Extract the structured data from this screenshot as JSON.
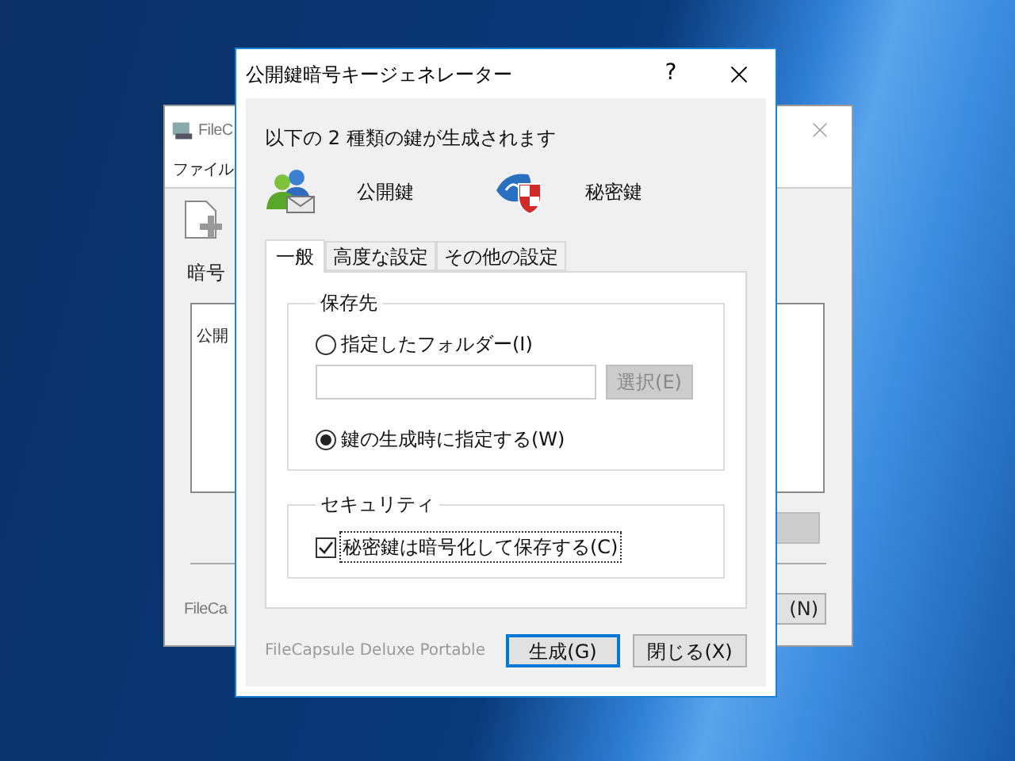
{
  "background_window": {
    "title": "FileC",
    "menu": [
      "ファイル"
    ],
    "label": "暗号",
    "list_item": "公開",
    "footer": "FileCa",
    "button": "(N)"
  },
  "dialog": {
    "title": "公開鍵暗号キージェネレーター",
    "help": "?",
    "intro": "以下の 2 種類の鍵が生成されます",
    "keys": [
      {
        "kind": "public",
        "label": "公開鍵"
      },
      {
        "kind": "private",
        "label": "秘密鍵"
      }
    ],
    "tabs": [
      {
        "label": "一般",
        "selected": true
      },
      {
        "label": "高度な設定",
        "selected": false
      },
      {
        "label": "その他の設定",
        "selected": false
      }
    ],
    "destination": {
      "title": "保存先",
      "options": [
        {
          "label": "指定したフォルダー(I)",
          "selected": false
        },
        {
          "label": "鍵の生成時に指定する(W)",
          "selected": true
        }
      ],
      "folder_field": {
        "disabled": true
      },
      "browse_button": {
        "label": "選択(E)",
        "disabled": true
      }
    },
    "security": {
      "title": "セキュリティ",
      "checkbox": {
        "label": "秘密鍵は暗号化して保存する(C)",
        "checked": true
      }
    },
    "footer": "FileCapsule Deluxe Portable",
    "buttons": [
      {
        "label": "生成(G)",
        "default": true
      },
      {
        "label": "閉じる(X)",
        "default": false
      }
    ]
  }
}
